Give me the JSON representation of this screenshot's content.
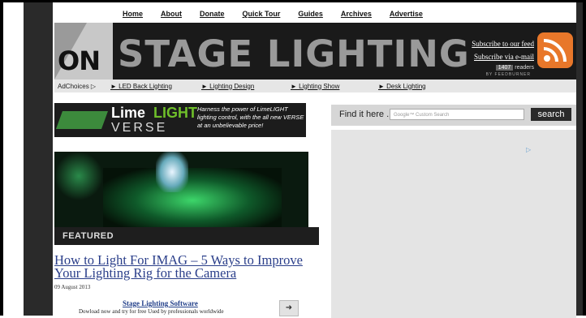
{
  "nav": {
    "items": [
      "Home",
      "About",
      "Donate",
      "Quick Tour",
      "Guides",
      "Archives",
      "Advertise"
    ]
  },
  "header": {
    "logo_prefix": "ON",
    "logo_main": "STAGE LIGHTING",
    "subscribe_feed": "Subscribe to our feed",
    "subscribe_email": "Subscribe via e-mail",
    "reader_count": "1407",
    "reader_label": "readers",
    "feedburner": "BY FEEDBURNER",
    "rss_icon": "rss-icon"
  },
  "adbar": {
    "adchoices": "AdChoices ▷",
    "links": [
      "► LED Back Lighting",
      "► Lighting Design",
      "► Lighting Show",
      "► Desk Lighting"
    ]
  },
  "banner": {
    "lime": "Lime",
    "light": "LIGHT",
    "verse": "VERSE",
    "tagline": "Harness the power of LimeLIGHT lighting control, with the all new VERSE at an unbelievable price!"
  },
  "featured": {
    "label": "FEATURED",
    "title": "How to Light For IMAG – 5 Ways to Improve Your Lighting Rig for the Camera",
    "date": "09 August 2013"
  },
  "promo": {
    "title": "Stage Lighting Software",
    "description": "Dowload now and try for free Used by professionals worldwide",
    "arrow": "➜"
  },
  "search": {
    "label": "Find it here ..",
    "placeholder": "Google™ Custom Search",
    "button": "search"
  },
  "ad": {
    "icon": "▷"
  }
}
